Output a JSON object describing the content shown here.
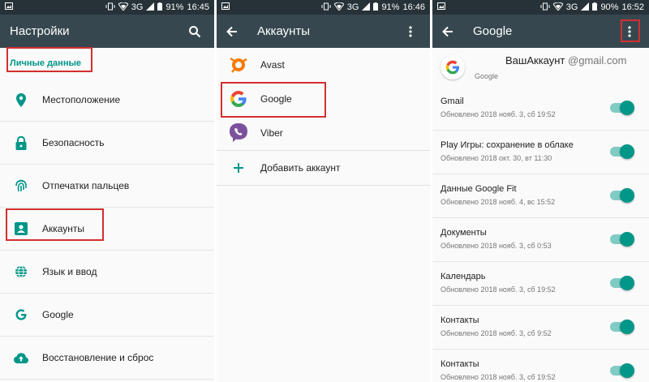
{
  "panel1": {
    "status": {
      "battery": "91%",
      "time": "16:45",
      "network": "3G"
    },
    "title": "Настройки",
    "section": "Личные данные",
    "items": [
      {
        "label": "Местоположение"
      },
      {
        "label": "Безопасность"
      },
      {
        "label": "Отпечатки пальцев"
      },
      {
        "label": "Аккаунты"
      },
      {
        "label": "Язык и ввод"
      },
      {
        "label": "Google"
      },
      {
        "label": "Восстановление и сброс"
      }
    ]
  },
  "panel2": {
    "status": {
      "battery": "91%",
      "time": "16:46",
      "network": "3G"
    },
    "title": "Аккаунты",
    "items": [
      {
        "label": "Avast"
      },
      {
        "label": "Google"
      },
      {
        "label": "Viber"
      }
    ],
    "add_label": "Добавить аккаунт"
  },
  "panel3": {
    "status": {
      "battery": "90%",
      "time": "16:52",
      "network": "3G"
    },
    "title": "Google",
    "account_name": "ВашАккаунт",
    "account_domain": "@gmail.com",
    "account_type": "Google",
    "sync_items": [
      {
        "title": "Gmail",
        "updated": "Обновлено 2018 нояб. 3, сб 19:52",
        "enabled": true
      },
      {
        "title": "Play Игры: сохранение в облаке",
        "updated": "Обновлено 2018 окт. 30, вт 11:30",
        "enabled": true
      },
      {
        "title": "Данные Google Fit",
        "updated": "Обновлено 2018 нояб. 4, вс 15:52",
        "enabled": true
      },
      {
        "title": "Документы",
        "updated": "Обновлено 2018 нояб. 3, сб 0:53",
        "enabled": true
      },
      {
        "title": "Календарь",
        "updated": "Обновлено 2018 нояб. 3, сб 19:52",
        "enabled": true
      },
      {
        "title": "Контакты",
        "updated": "Обновлено 2018 нояб. 3, сб 9:52",
        "enabled": true
      },
      {
        "title": "Контакты",
        "updated": "Обновлено 2018 нояб. 3, сб 19:52",
        "enabled": true
      }
    ]
  },
  "colors": {
    "accent": "#009688",
    "appbar": "#37474f",
    "statusbar": "#263238",
    "highlight": "#d32f2f"
  }
}
